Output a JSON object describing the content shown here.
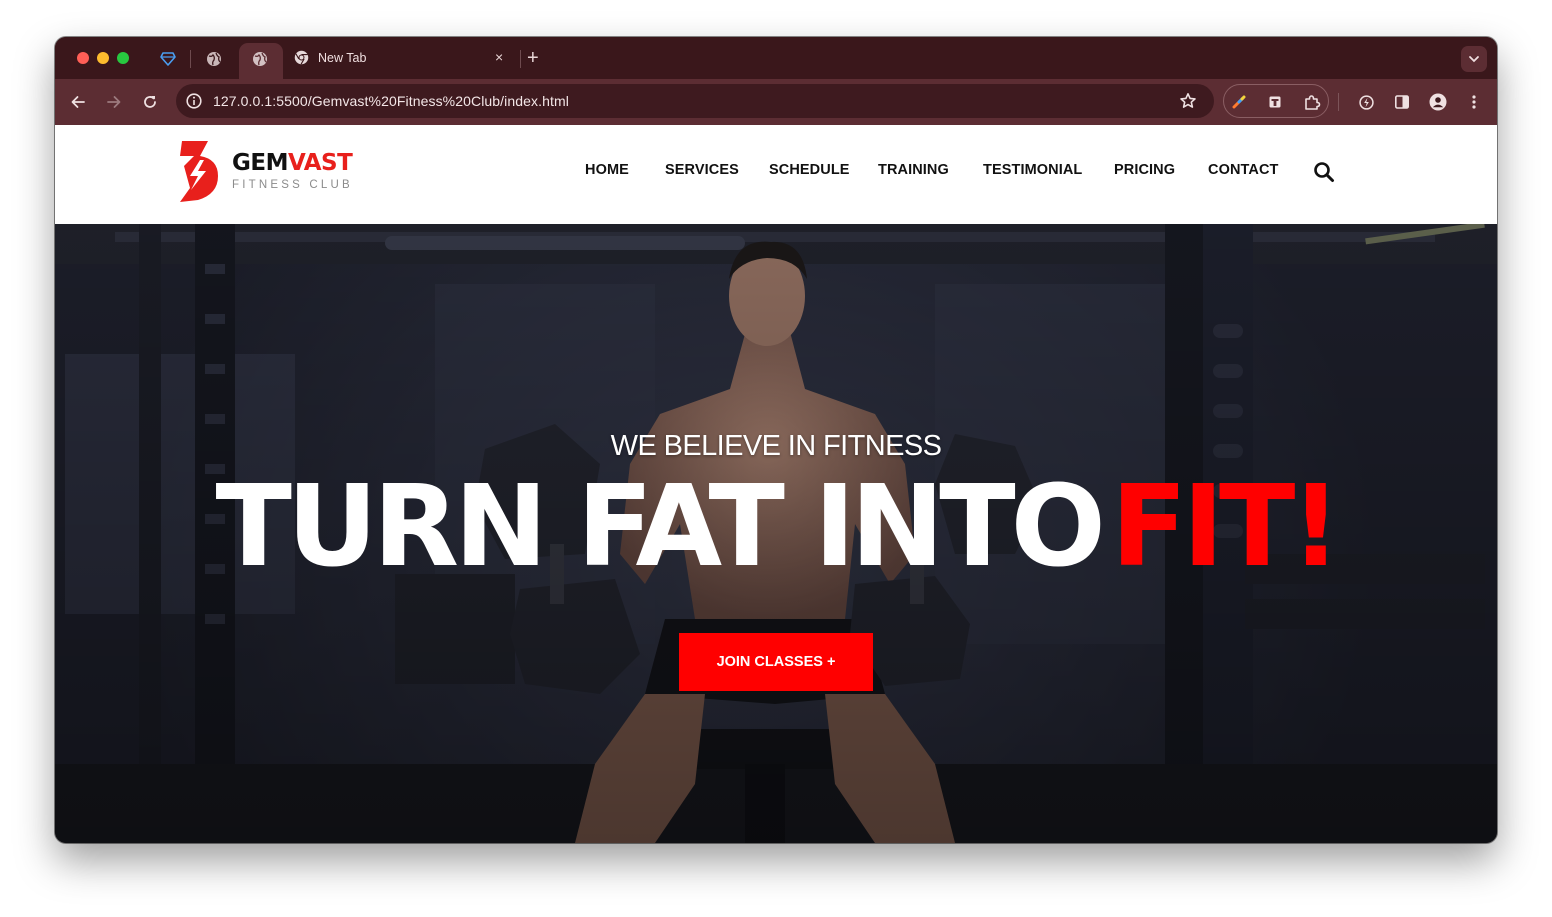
{
  "browser": {
    "tabs": [
      {
        "title": "",
        "icon": "gem-icon",
        "pinned": true
      },
      {
        "title": "",
        "icon": "globe-icon",
        "pinned": true
      },
      {
        "title": "",
        "icon": "globe-icon",
        "active": true
      },
      {
        "title": "New Tab",
        "icon": "chrome-icon"
      }
    ],
    "new_tab_symbol": "+",
    "close_symbol": "×",
    "url": "127.0.0.1:5500/Gemvast%20Fitness%20Club/index.html",
    "theme": {
      "frame": "#3a171b",
      "toolbar": "#5c2d33",
      "omnibox": "#3e1a1f"
    }
  },
  "site": {
    "logo": {
      "word_dark": "GEM",
      "word_accent": "VAST",
      "tagline": "FITNESS CLUB",
      "accent_color": "#e8201c"
    },
    "nav": [
      "HOME",
      "SERVICES",
      "SCHEDULE",
      "TRAINING",
      "TESTIMONIAL",
      "PRICING",
      "CONTACT"
    ],
    "hero": {
      "tagline": "WE BELIEVE IN FITNESS",
      "title_white": "TURN FAT INTO",
      "title_red": "FIT!",
      "cta": "JOIN CLASSES +",
      "accent_color": "#ff0000"
    }
  }
}
